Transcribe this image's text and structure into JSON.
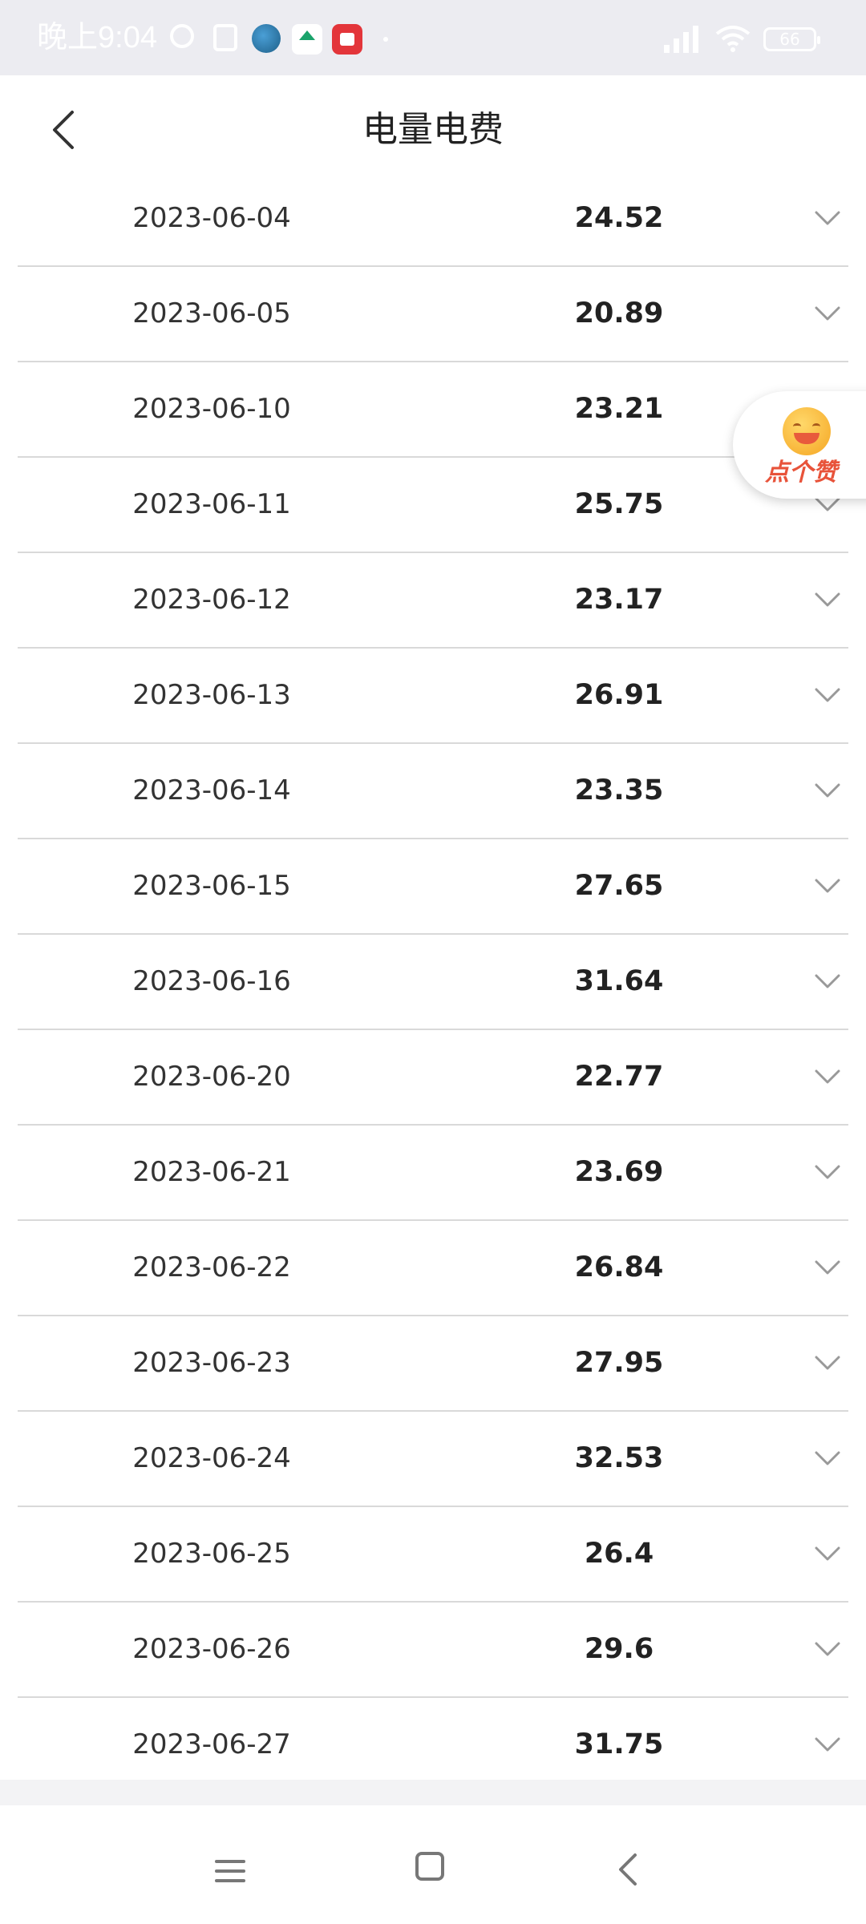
{
  "status_bar": {
    "time": "晚上9:04",
    "battery": "66",
    "icons": [
      "alarm-icon",
      "nfc-icon",
      "state-grid-app-icon",
      "home-app-icon",
      "red-app-icon",
      "signal-icon",
      "wifi-icon",
      "battery-icon"
    ]
  },
  "header": {
    "title": "电量电费",
    "back_icon": "chevron-left-icon"
  },
  "records": [
    {
      "date": "2023-06-04",
      "amount": "24.52"
    },
    {
      "date": "2023-06-05",
      "amount": "20.89"
    },
    {
      "date": "2023-06-10",
      "amount": "23.21"
    },
    {
      "date": "2023-06-11",
      "amount": "25.75"
    },
    {
      "date": "2023-06-12",
      "amount": "23.17"
    },
    {
      "date": "2023-06-13",
      "amount": "26.91"
    },
    {
      "date": "2023-06-14",
      "amount": "23.35"
    },
    {
      "date": "2023-06-15",
      "amount": "27.65"
    },
    {
      "date": "2023-06-16",
      "amount": "31.64"
    },
    {
      "date": "2023-06-20",
      "amount": "22.77"
    },
    {
      "date": "2023-06-21",
      "amount": "23.69"
    },
    {
      "date": "2023-06-22",
      "amount": "26.84"
    },
    {
      "date": "2023-06-23",
      "amount": "27.95"
    },
    {
      "date": "2023-06-24",
      "amount": "32.53"
    },
    {
      "date": "2023-06-25",
      "amount": "26.4"
    },
    {
      "date": "2023-06-26",
      "amount": "29.6"
    },
    {
      "date": "2023-06-27",
      "amount": "31.75"
    }
  ],
  "like_button": {
    "label": "点个赞",
    "icon": "smile-face-icon"
  },
  "nav_bar": {
    "icons": [
      "menu-icon",
      "home-square-icon",
      "back-triangle-icon"
    ]
  },
  "colors": {
    "status_bar_bg": "#ececf1",
    "divider": "#d9d9d9",
    "like_text": "#e8533a",
    "text": "#222222"
  }
}
